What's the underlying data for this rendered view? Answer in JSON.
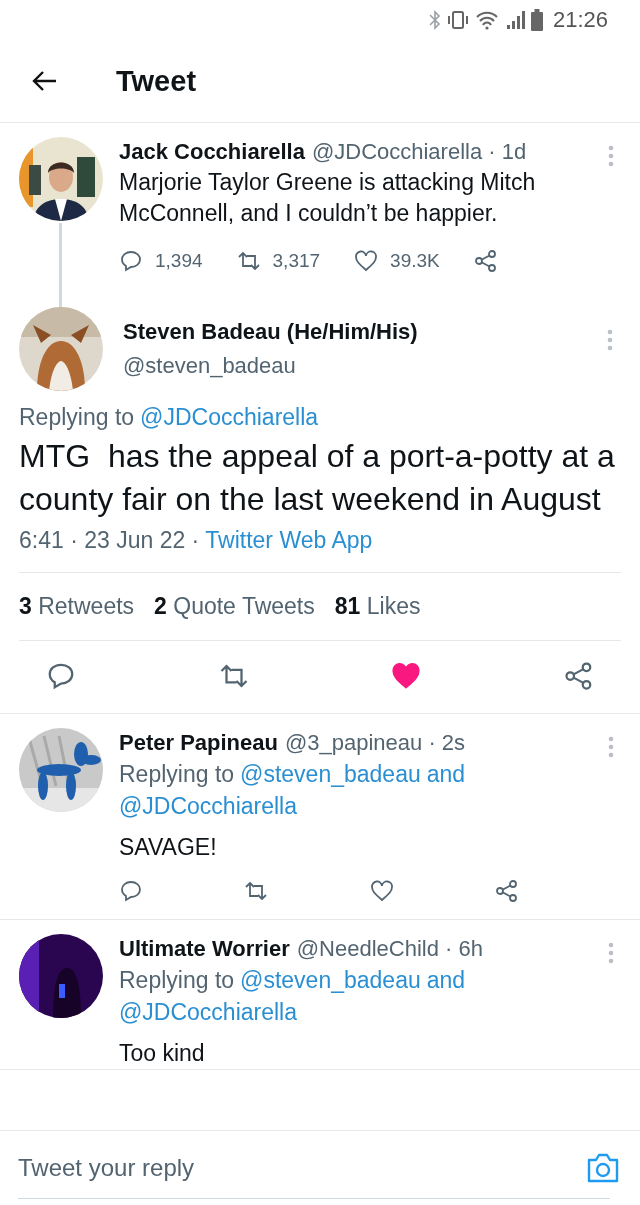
{
  "status_bar": {
    "time": "21:26"
  },
  "header": {
    "title": "Tweet"
  },
  "parent_tweet": {
    "name": "Jack Cocchiarella",
    "handle_time": "@JDCocchiarella · 1d",
    "text": "Marjorie Taylor Greene is attacking Mitch McConnell, and I couldn’t be happier.",
    "replies": "1,394",
    "retweets": "3,317",
    "likes": "39.3K",
    "liked": false
  },
  "main_tweet": {
    "name": "Steven Badeau (He/Him/His)",
    "handle": "@steven_badeau",
    "replying_label": "Replying to",
    "replying_to": [
      {
        "text": "@JDCocchiarella"
      }
    ],
    "text": "MTG  has the appeal of a port-a-potty at a county fair on the last weekend in August",
    "timestamp": "6:41 · 23 Jun 22 ·",
    "source": "Twitter Web App",
    "stats": [
      {
        "count": "3",
        "label": "Retweets"
      },
      {
        "count": "2",
        "label": "Quote Tweets"
      },
      {
        "count": "81",
        "label": "Likes"
      }
    ],
    "liked": true
  },
  "replies": [
    {
      "name": "Peter Papineau",
      "handle_time": "@3_papineau · 2s",
      "replying_label": "Replying to",
      "replying_to": [
        {
          "text": "@steven_badeau"
        },
        {
          "text": "and"
        },
        {
          "text": "@JDCocchiarella"
        }
      ],
      "text": "SAVAGE!",
      "liked": false
    },
    {
      "name": "Ultimate Worrier",
      "handle_time": "@NeedleChild · 6h",
      "replying_label": "Replying to",
      "replying_to": [
        {
          "text": "@steven_badeau"
        },
        {
          "text": "and"
        },
        {
          "text": "@JDCocchiarella"
        }
      ],
      "text": "Too kind"
    }
  ],
  "reply_bar": {
    "placeholder": "Tweet your reply"
  }
}
